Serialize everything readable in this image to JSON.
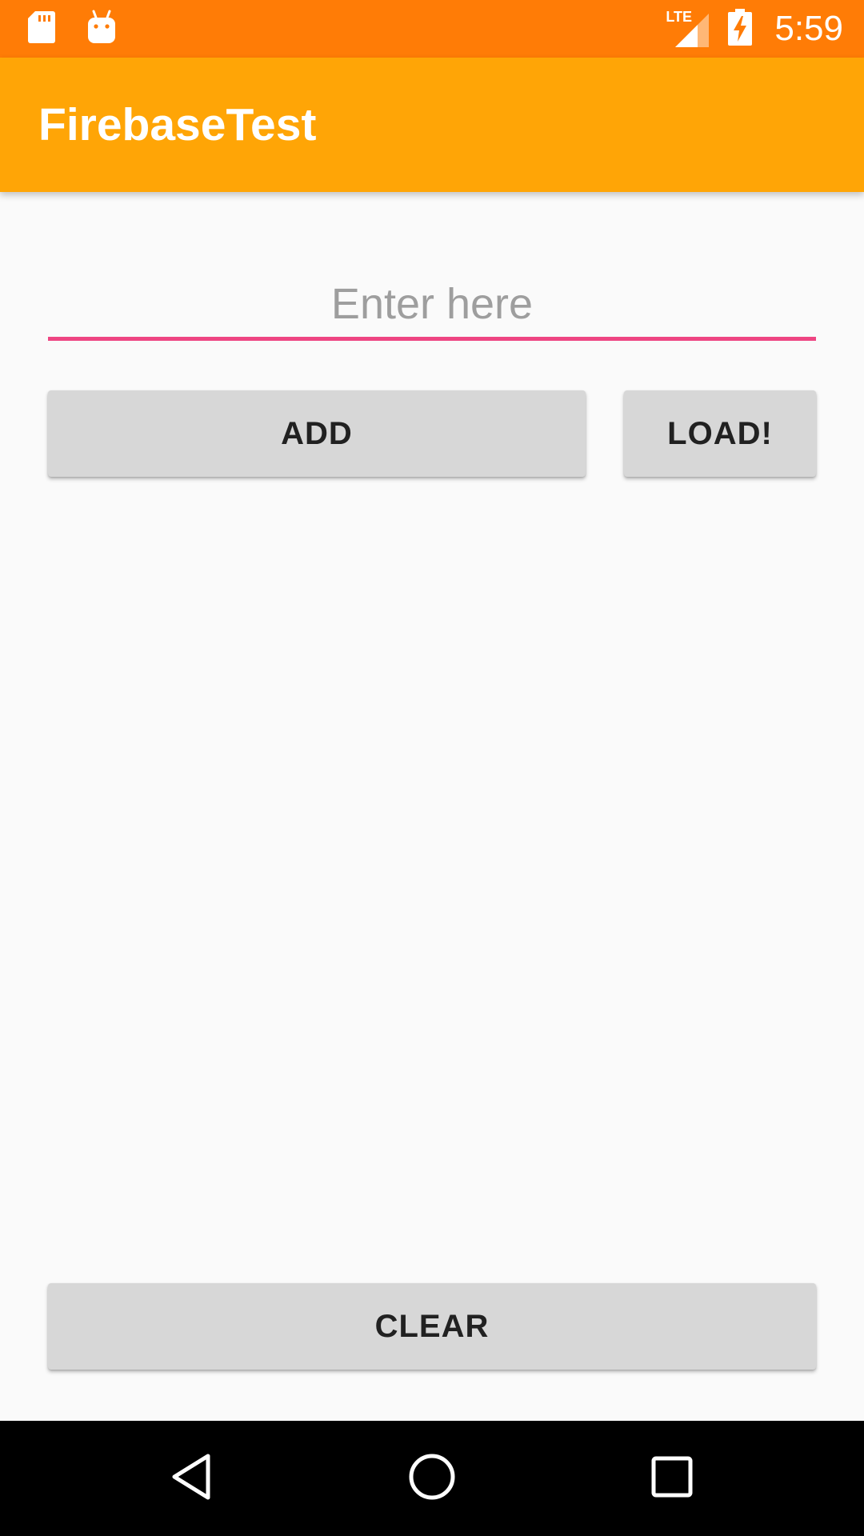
{
  "status_bar": {
    "time": "5:59",
    "network_label": "LTE",
    "left_icons": [
      "sd-card-icon",
      "android-debug-icon"
    ],
    "right_icons": [
      "lte-signal-icon",
      "battery-charging-icon"
    ],
    "background_color": "#ff7c06"
  },
  "app_bar": {
    "title": "FirebaseTest",
    "background_color": "#ffa506"
  },
  "input": {
    "placeholder": "Enter here",
    "value": "",
    "underline_color": "#ee4582"
  },
  "buttons": {
    "add_label": "ADD",
    "load_label": "LOAD!",
    "clear_label": "CLEAR"
  },
  "nav_bar": {
    "icons": [
      "back-icon",
      "home-icon",
      "recents-icon"
    ]
  }
}
